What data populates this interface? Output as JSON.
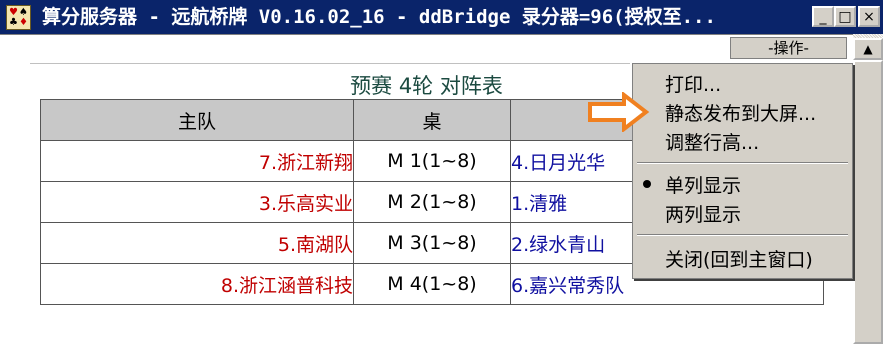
{
  "window": {
    "title": "算分服务器 - 远航桥牌 V0.16.02_16 - ddBridge 录分器=96(授权至...",
    "controls": {
      "minimize": "_",
      "maximize": "□",
      "close": "×"
    }
  },
  "toolbar": {
    "ops_label": "-操作-"
  },
  "heading": "预赛 4轮 对阵表",
  "table": {
    "headers": {
      "home": "主队",
      "table": "桌",
      "away": ""
    },
    "rows": [
      {
        "home": "7.浙江新翔",
        "table": "M 1(1~8)",
        "away": "4.日月光华"
      },
      {
        "home": "3.乐高实业",
        "table": "M 2(1~8)",
        "away": "1.清雅"
      },
      {
        "home": "5.南湖队",
        "table": "M 3(1~8)",
        "away": "2.绿水青山"
      },
      {
        "home": "8.浙江涵普科技",
        "table": "M 4(1~8)",
        "away": "6.嘉兴常秀队"
      }
    ]
  },
  "menu": {
    "items": [
      {
        "label": "打印..."
      },
      {
        "label": "静态发布到大屏..."
      },
      {
        "label": "调整行高..."
      },
      {
        "label": "单列显示",
        "checked": true
      },
      {
        "label": "两列显示",
        "checked": false
      },
      {
        "label": "关闭(回到主窗口)"
      }
    ]
  },
  "colors": {
    "titlebar": "#0a246a",
    "home_team": "#c00000",
    "away_team": "#1010a0",
    "annotation_arrow": "#f08020"
  },
  "icons": [
    "app-icon",
    "minimize-icon",
    "maximize-icon",
    "close-icon",
    "scroll-up-icon",
    "radio-dot-icon",
    "annotation-arrow-icon"
  ]
}
